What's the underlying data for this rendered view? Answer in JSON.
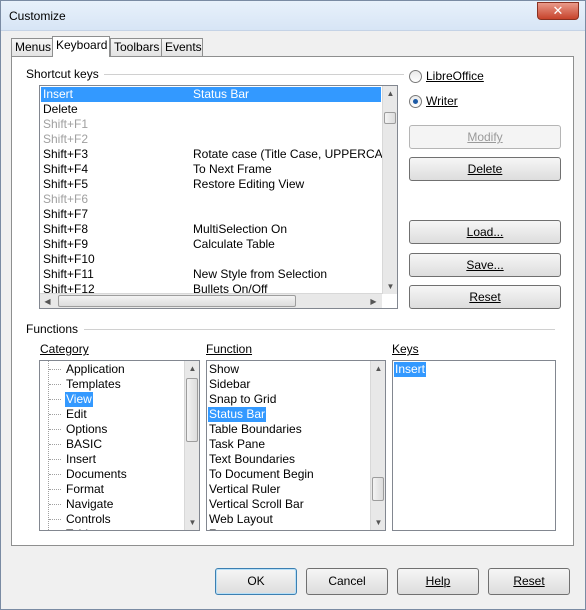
{
  "window": {
    "title": "Customize",
    "close_glyph": "✕"
  },
  "tabs": [
    {
      "label": "Menus",
      "active": false
    },
    {
      "label": "Keyboard",
      "active": true
    },
    {
      "label": "Toolbars",
      "active": false
    },
    {
      "label": "Events",
      "active": false
    }
  ],
  "shortcut_keys": {
    "label": "Shortcut keys",
    "rows": [
      {
        "key": "Insert",
        "command": "Status Bar",
        "selected": true,
        "disabled": false
      },
      {
        "key": "Delete",
        "command": "",
        "selected": false,
        "disabled": false
      },
      {
        "key": "Shift+F1",
        "command": "",
        "selected": false,
        "disabled": true
      },
      {
        "key": "Shift+F2",
        "command": "",
        "selected": false,
        "disabled": true
      },
      {
        "key": "Shift+F3",
        "command": "Rotate case (Title Case, UPPERCASE",
        "selected": false,
        "disabled": false
      },
      {
        "key": "Shift+F4",
        "command": "To Next Frame",
        "selected": false,
        "disabled": false
      },
      {
        "key": "Shift+F5",
        "command": "Restore Editing View",
        "selected": false,
        "disabled": false
      },
      {
        "key": "Shift+F6",
        "command": "",
        "selected": false,
        "disabled": true
      },
      {
        "key": "Shift+F7",
        "command": "",
        "selected": false,
        "disabled": false
      },
      {
        "key": "Shift+F8",
        "command": "MultiSelection On",
        "selected": false,
        "disabled": false
      },
      {
        "key": "Shift+F9",
        "command": "Calculate Table",
        "selected": false,
        "disabled": false
      },
      {
        "key": "Shift+F10",
        "command": "",
        "selected": false,
        "disabled": false
      },
      {
        "key": "Shift+F11",
        "command": "New Style from Selection",
        "selected": false,
        "disabled": false
      },
      {
        "key": "Shift+F12",
        "command": "Bullets On/Off",
        "selected": false,
        "disabled": false
      }
    ]
  },
  "scope": {
    "libreoffice_label": "LibreOffice",
    "writer_label": "Writer",
    "selected": "Writer"
  },
  "buttons": {
    "modify": "Modify",
    "delete": "Delete",
    "load": "Load...",
    "save": "Save...",
    "reset": "Reset"
  },
  "functions": {
    "label": "Functions",
    "category_label": "Category",
    "function_label": "Function",
    "keys_label": "Keys",
    "categories": [
      {
        "label": "Application",
        "selected": false
      },
      {
        "label": "Templates",
        "selected": false
      },
      {
        "label": "View",
        "selected": true
      },
      {
        "label": "Edit",
        "selected": false
      },
      {
        "label": "Options",
        "selected": false
      },
      {
        "label": "BASIC",
        "selected": false
      },
      {
        "label": "Insert",
        "selected": false
      },
      {
        "label": "Documents",
        "selected": false
      },
      {
        "label": "Format",
        "selected": false
      },
      {
        "label": "Navigate",
        "selected": false
      },
      {
        "label": "Controls",
        "selected": false
      },
      {
        "label": "Table",
        "selected": false
      }
    ],
    "function_items": [
      {
        "label": "Show",
        "selected": false
      },
      {
        "label": "Sidebar",
        "selected": false
      },
      {
        "label": "Snap to Grid",
        "selected": false
      },
      {
        "label": "Status Bar",
        "selected": true
      },
      {
        "label": "Table Boundaries",
        "selected": false
      },
      {
        "label": "Task Pane",
        "selected": false
      },
      {
        "label": "Text Boundaries",
        "selected": false
      },
      {
        "label": "To Document Begin",
        "selected": false
      },
      {
        "label": "Vertical Ruler",
        "selected": false
      },
      {
        "label": "Vertical Scroll Bar",
        "selected": false
      },
      {
        "label": "Web Layout",
        "selected": false
      },
      {
        "label": "Zoom",
        "selected": false
      }
    ],
    "keys": [
      {
        "label": "Insert",
        "selected": true
      }
    ]
  },
  "footer": {
    "ok": "OK",
    "cancel": "Cancel",
    "help": "Help",
    "reset": "Reset"
  }
}
